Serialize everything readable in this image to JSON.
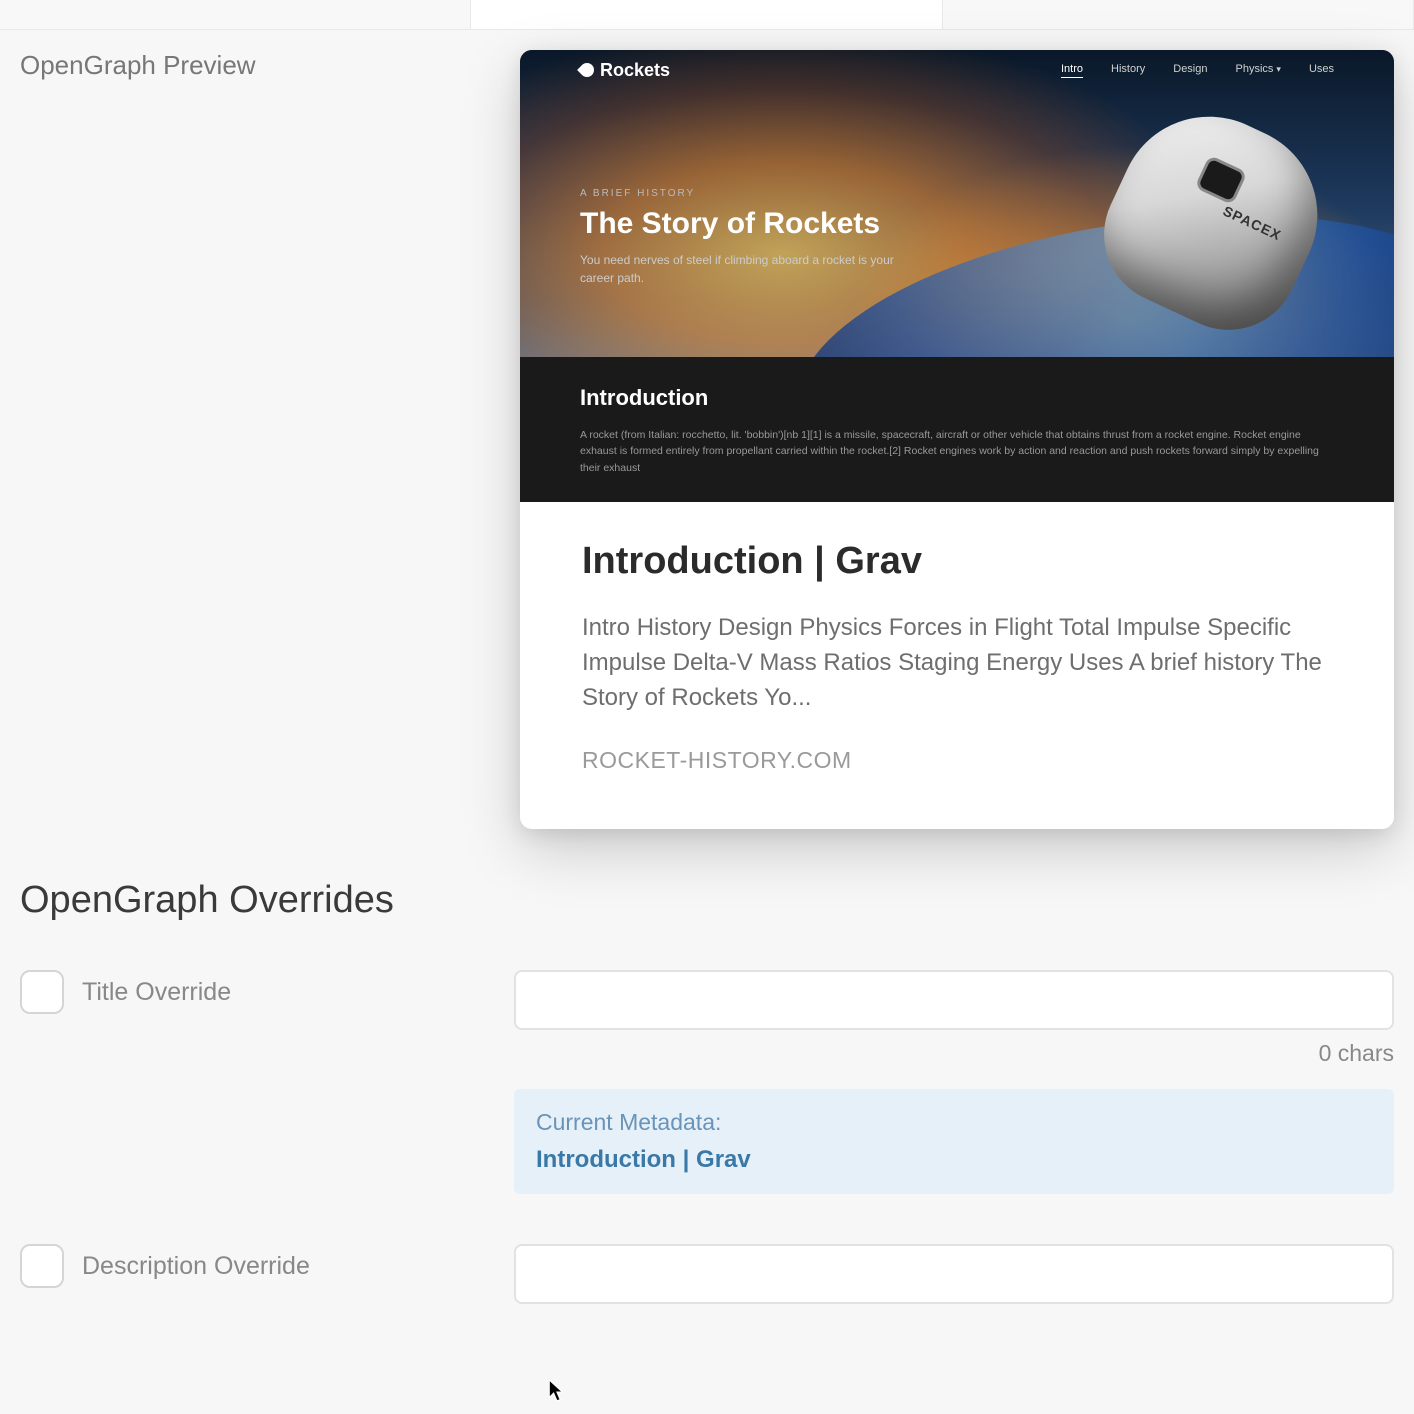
{
  "section_preview_label": "OpenGraph Preview",
  "preview_card": {
    "thumb": {
      "brand": "Rockets",
      "nav": [
        "Intro",
        "History",
        "Design",
        "Physics",
        "Uses"
      ],
      "nav_active": "Intro",
      "eyebrow": "A BRIEF HISTORY",
      "hero_title": "The Story of Rockets",
      "hero_sub": "You need nerves of steel if climbing aboard a rocket is your career path.",
      "capsule_label": "SPACEX",
      "section_heading": "Introduction",
      "section_text": "A rocket (from Italian: rocchetto, lit. 'bobbin')[nb 1][1] is a missile, spacecraft, aircraft or other vehicle that obtains thrust from a rocket engine. Rocket engine exhaust is formed entirely from propellant carried within the rocket.[2] Rocket engines work by action and reaction and push rockets forward simply by expelling their exhaust"
    },
    "title": "Introduction | Grav",
    "description": "Intro History Design Physics Forces in Flight Total Impulse Specific Impulse Delta-V Mass Ratios Staging Energy Uses A brief history The Story of Rockets Yo...",
    "domain": "ROCKET-HISTORY.COM"
  },
  "overrides_heading": "OpenGraph Overrides",
  "fields": {
    "title": {
      "label": "Title Override",
      "value": "",
      "char_count": "0 chars",
      "current_meta_label": "Current Metadata:",
      "current_meta_value": "Introduction | Grav"
    },
    "description": {
      "label": "Description Override",
      "value": ""
    }
  }
}
